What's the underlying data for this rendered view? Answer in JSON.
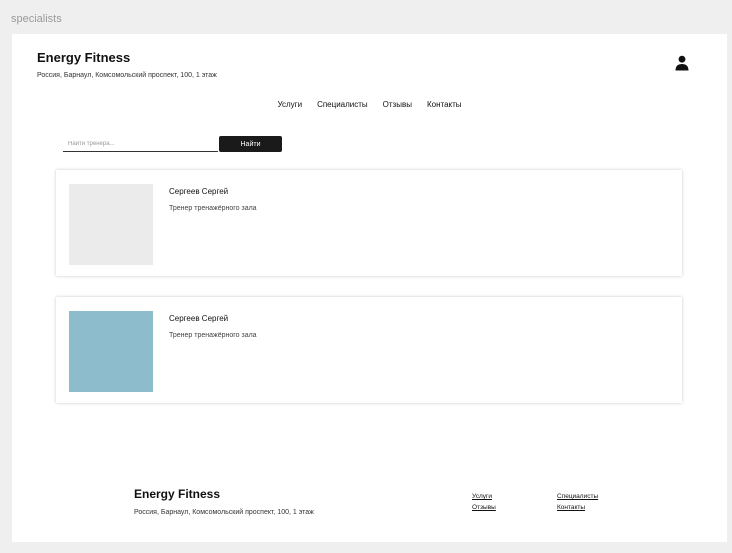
{
  "frame_label": "specialists",
  "header": {
    "title": "Energy Fitness",
    "address": "Россия, Барнаул, Комсомольский проспект, 100, 1 этаж",
    "user_icon": "user-icon"
  },
  "nav": {
    "items": [
      "Услуги",
      "Специалисты",
      "Отзывы",
      "Контакты"
    ]
  },
  "search": {
    "placeholder": "Найти тренера...",
    "value": "",
    "button_label": "Найти"
  },
  "specialists": [
    {
      "name": "Сергеев Сергей",
      "role": "Тренер тренажёрного зала",
      "photo_color": "#ebebeb"
    },
    {
      "name": "Сергеев Сергей",
      "role": "Тренер тренажёрного зала",
      "photo_color": "#8dbccc"
    }
  ],
  "footer": {
    "title": "Energy Fitness",
    "address": "Россия, Барнаул, Комсомольский проспект, 100, 1 этаж",
    "links": [
      "Услуги",
      "Специалисты",
      "Отзывы",
      "Контакты"
    ]
  }
}
